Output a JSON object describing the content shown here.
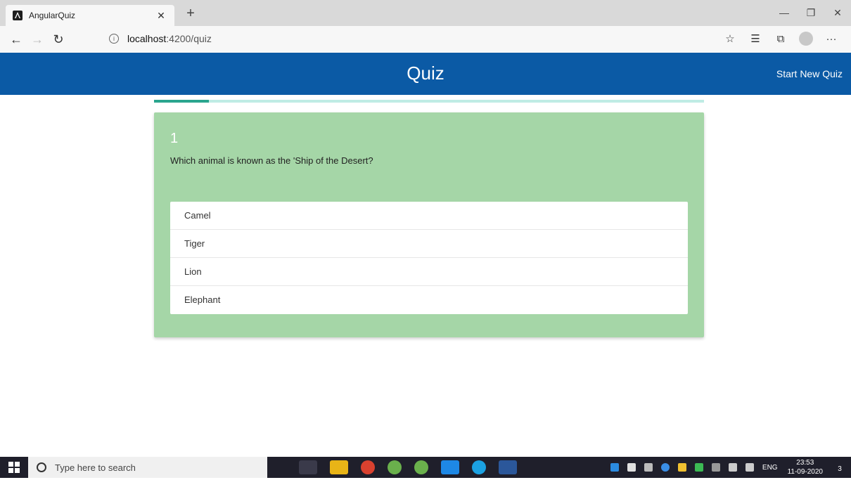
{
  "browser": {
    "tab_title": "AngularQuiz",
    "url_host": "localhost",
    "url_rest": ":4200/quiz"
  },
  "app": {
    "title": "Quiz",
    "start_new_label": "Start New Quiz"
  },
  "progress": {
    "value": 0.1
  },
  "question": {
    "number": "1",
    "text": "Which animal is known as the 'Ship of the Desert?",
    "options": [
      "Camel",
      "Tiger",
      "Lion",
      "Elephant"
    ]
  },
  "taskbar": {
    "search_placeholder": "Type here to search",
    "lang": "ENG",
    "time": "23:53",
    "date": "11-09-2020",
    "notification_count": "3"
  },
  "colors": {
    "header": "#0b5aa5",
    "card": "#a5d6a7",
    "progress_fill": "#2aa58e",
    "progress_track": "#bfece4"
  }
}
